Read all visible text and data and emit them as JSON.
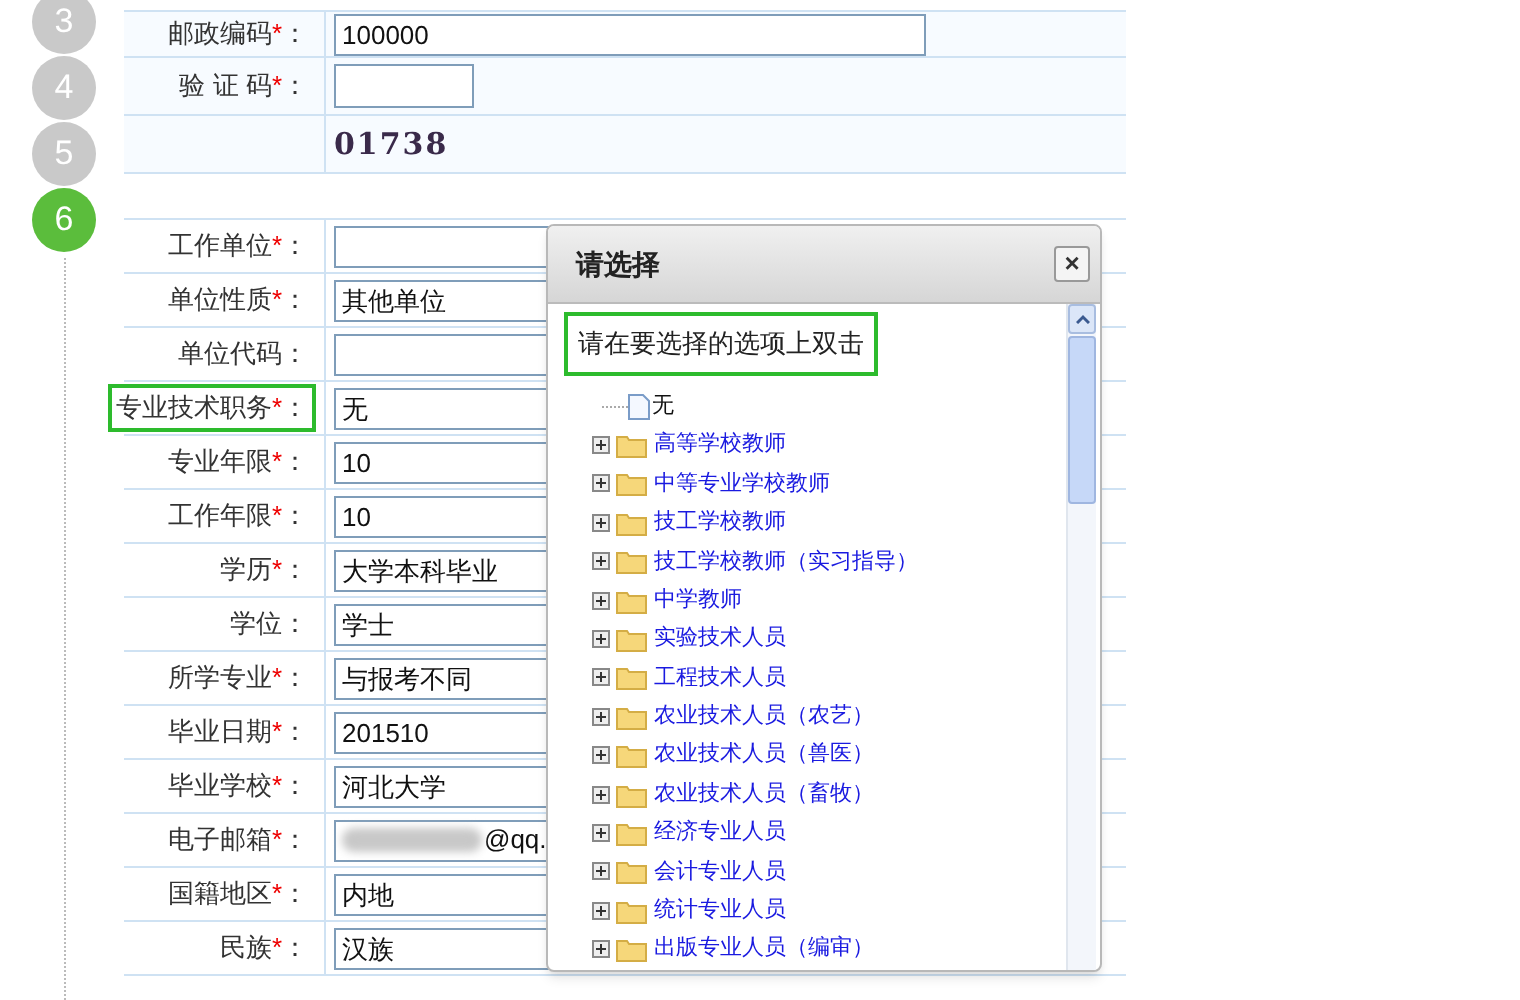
{
  "steps": [
    {
      "label": "3",
      "selected": false
    },
    {
      "label": "4",
      "selected": false
    },
    {
      "label": "5",
      "selected": false
    },
    {
      "label": "6",
      "selected": true
    }
  ],
  "top_form": [
    {
      "label": "邮政编码",
      "required": true,
      "kind": "text",
      "value": "100000"
    },
    {
      "label": "验 证 码",
      "required": true,
      "kind": "short"
    },
    {
      "kind": "captcha",
      "value": "01738"
    }
  ],
  "form": [
    {
      "label": "工作单位",
      "required": true,
      "highlighted": false,
      "kind": "text"
    },
    {
      "label": "单位性质",
      "required": true,
      "value": "其他单位",
      "highlighted": false,
      "kind": "text"
    },
    {
      "label": "单位代码",
      "required": false,
      "highlighted": false,
      "kind": "text"
    },
    {
      "label": "专业技术职务",
      "required": true,
      "value": "无",
      "highlighted": true,
      "kind": "text"
    },
    {
      "label": "专业年限",
      "required": true,
      "value": "10",
      "highlighted": false,
      "kind": "text"
    },
    {
      "label": "工作年限",
      "required": true,
      "value": "10",
      "highlighted": false,
      "kind": "text"
    },
    {
      "label": "学历",
      "required": true,
      "value": "大学本科毕业",
      "highlighted": false,
      "kind": "text"
    },
    {
      "label": "学位",
      "required": false,
      "value": "学士",
      "highlighted": false,
      "kind": "text"
    },
    {
      "label": "所学专业",
      "required": true,
      "value": "与报考不同",
      "highlighted": false,
      "kind": "text"
    },
    {
      "label": "毕业日期",
      "required": true,
      "value": "201510",
      "highlighted": false,
      "kind": "text"
    },
    {
      "label": "毕业学校",
      "required": true,
      "value": "河北大学",
      "highlighted": false,
      "kind": "text"
    },
    {
      "label": "电子邮箱",
      "required": true,
      "value": "@qq.",
      "highlighted": false,
      "kind": "blurred"
    },
    {
      "label": "国籍地区",
      "required": true,
      "value": "内地",
      "highlighted": false,
      "kind": "text"
    },
    {
      "label": "民族",
      "required": true,
      "value": "汉族",
      "highlighted": false,
      "kind": "text"
    }
  ],
  "required_mark": "*",
  "label_suffix": "：",
  "dialog": {
    "title": "请选择",
    "close": "×",
    "instruction": "请在要选择的选项上双击",
    "instruction_highlighted": true,
    "tree": [
      {
        "kind": "leaf",
        "label": "无"
      },
      {
        "kind": "folder",
        "label": "高等学校教师",
        "expanded": false
      },
      {
        "kind": "folder",
        "label": "中等专业学校教师",
        "expanded": false
      },
      {
        "kind": "folder",
        "label": "技工学校教师",
        "expanded": false
      },
      {
        "kind": "folder",
        "label": "技工学校教师（实习指导）",
        "expanded": false
      },
      {
        "kind": "folder",
        "label": "中学教师",
        "expanded": false
      },
      {
        "kind": "folder",
        "label": "实验技术人员",
        "expanded": false
      },
      {
        "kind": "folder",
        "label": "工程技术人员",
        "expanded": false
      },
      {
        "kind": "folder",
        "label": "农业技术人员（农艺）",
        "expanded": false
      },
      {
        "kind": "folder",
        "label": "农业技术人员（兽医）",
        "expanded": false
      },
      {
        "kind": "folder",
        "label": "农业技术人员（畜牧）",
        "expanded": false
      },
      {
        "kind": "folder",
        "label": "经济专业人员",
        "expanded": false
      },
      {
        "kind": "folder",
        "label": "会计专业人员",
        "expanded": false
      },
      {
        "kind": "folder",
        "label": "统计专业人员",
        "expanded": false
      },
      {
        "kind": "folder",
        "label": "出版专业人员（编审）",
        "expanded": false
      }
    ]
  }
}
